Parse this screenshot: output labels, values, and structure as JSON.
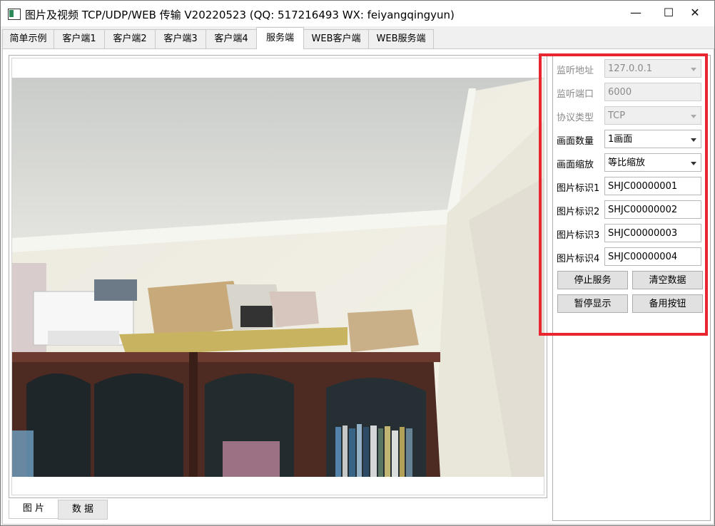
{
  "window": {
    "title": "图片及视频 TCP/UDP/WEB 传输 V20220523 (QQ: 517216493 WX: feiyangqingyun)",
    "minimize": "—",
    "maximize": "☐",
    "close": "✕"
  },
  "tabs": [
    {
      "label": "简单示例"
    },
    {
      "label": "客户端1"
    },
    {
      "label": "客户端2"
    },
    {
      "label": "客户端3"
    },
    {
      "label": "客户端4"
    },
    {
      "label": "服务端"
    },
    {
      "label": "WEB客户端"
    },
    {
      "label": "WEB服务端"
    }
  ],
  "active_tab": "服务端",
  "bottom_tabs": [
    {
      "label": "图 片"
    },
    {
      "label": "数 据"
    }
  ],
  "settings": {
    "listen_address": {
      "label": "监听地址",
      "value": "127.0.0.1"
    },
    "listen_port": {
      "label": "监听端口",
      "value": "6000"
    },
    "protocol": {
      "label": "协议类型",
      "value": "TCP"
    },
    "view_count": {
      "label": "画面数量",
      "value": "1画面"
    },
    "view_scale": {
      "label": "画面缩放",
      "value": "等比缩放"
    },
    "image_id1": {
      "label": "图片标识1",
      "value": "SHJC00000001"
    },
    "image_id2": {
      "label": "图片标识2",
      "value": "SHJC00000002"
    },
    "image_id3": {
      "label": "图片标识3",
      "value": "SHJC00000003"
    },
    "image_id4": {
      "label": "图片标识4",
      "value": "SHJC00000004"
    }
  },
  "buttons": {
    "stop_service": "停止服务",
    "clear_data": "清空数据",
    "pause_display": "暂停显示",
    "spare_button": "备用按钮"
  },
  "colors": {
    "highlight_border": "#e8262f"
  }
}
